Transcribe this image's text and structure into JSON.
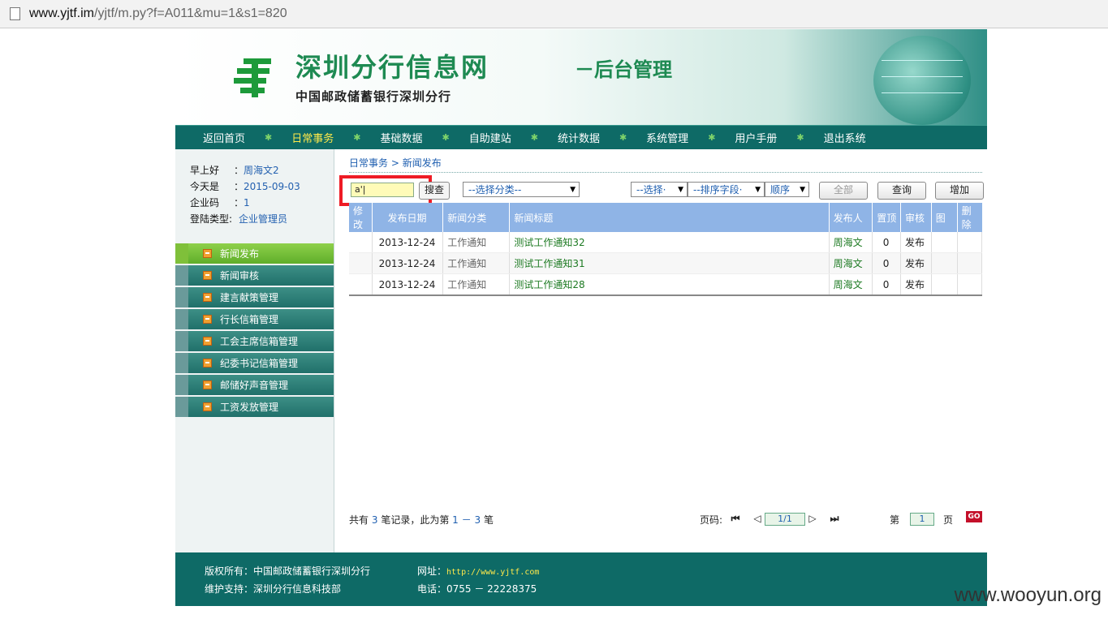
{
  "browser": {
    "url_host": "www.yjtf.im",
    "url_path": "/yjtf/m.py?f=A011&mu=1&s1=820"
  },
  "banner": {
    "title": "深圳分行信息网",
    "subtitle": "－后台管理",
    "org": "中国邮政储蓄银行深圳分行"
  },
  "nav": {
    "items": [
      {
        "label": "返回首页"
      },
      {
        "label": "日常事务",
        "active": true
      },
      {
        "label": "基础数据"
      },
      {
        "label": "自助建站"
      },
      {
        "label": "统计数据"
      },
      {
        "label": "系统管理"
      },
      {
        "label": "用户手册"
      },
      {
        "label": "退出系统"
      }
    ],
    "separator": "✱"
  },
  "user": {
    "greeting_label": "早上好",
    "greeting_value": "周海文2",
    "today_label": "今天是",
    "today_value": "2015-09-03",
    "company_label": "企业码",
    "company_value": "1",
    "login_type_label": "登陆类型:",
    "login_type_value": "企业管理员",
    "sep": "："
  },
  "menu": {
    "items": [
      {
        "label": "新闻发布",
        "active": true
      },
      {
        "label": "新闻审核"
      },
      {
        "label": "建言献策管理"
      },
      {
        "label": "行长信箱管理"
      },
      {
        "label": "工会主席信箱管理"
      },
      {
        "label": "纪委书记信箱管理"
      },
      {
        "label": "邮储好声音管理"
      },
      {
        "label": "工资发放管理"
      }
    ]
  },
  "breadcrumb": {
    "parent": "日常事务",
    "sep": " > ",
    "current": "新闻发布"
  },
  "toolbar": {
    "search_value": "a'|",
    "search_button": "搜查",
    "category_select": "--选择分类--",
    "choose_select": "--选择·",
    "sort_select": "--排序字段·",
    "order_select": "顺序",
    "all_button": "全部",
    "query_button": "查询",
    "add_button": "增加",
    "arrow": "▼"
  },
  "table": {
    "headers": [
      "修改",
      "发布日期",
      "新闻分类",
      "新闻标题",
      "发布人",
      "置顶",
      "审核",
      "图",
      "删除"
    ],
    "rows": [
      {
        "date": "2013-12-24",
        "category": "工作通知",
        "title": "测试工作通知32",
        "author": "周海文",
        "top": "0",
        "status": "发布"
      },
      {
        "date": "2013-12-24",
        "category": "工作通知",
        "title": "测试工作通知31",
        "author": "周海文",
        "top": "0",
        "status": "发布"
      },
      {
        "date": "2013-12-24",
        "category": "工作通知",
        "title": "测试工作通知28",
        "author": "周海文",
        "top": "0",
        "status": "发布"
      }
    ]
  },
  "pager": {
    "total_prefix": "共有",
    "total": "3",
    "total_mid": "笔记录，此为第",
    "from": "1",
    "dash": "－",
    "to": "3",
    "total_suffix": "笔",
    "page_label": "页码:",
    "page_value": "1/1",
    "goto_prefix": "第",
    "goto_value": "1",
    "goto_suffix": "页",
    "go_button": "GO"
  },
  "footer": {
    "copyright": "版权所有：中国邮政储蓄银行深圳分行",
    "support": "维护支持：深圳分行信息科技部",
    "site_label": "网址：",
    "site_url": "http://www.yjtf.com",
    "phone": "电话：0755 － 22228375"
  },
  "watermark": "www.wooyun.org"
}
